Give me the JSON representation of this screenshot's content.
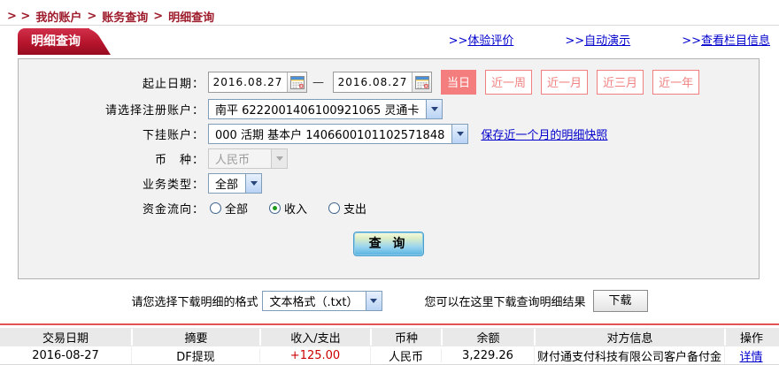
{
  "breadcrumb": {
    "prefix": "> >",
    "separator": ">",
    "items": [
      "我的账户",
      "账务查询",
      "明细查询"
    ]
  },
  "panel": {
    "tab_title": "明细查询",
    "links": [
      {
        "prefix": ">>",
        "label": "体验评价"
      },
      {
        "prefix": ">>",
        "label": "自动演示"
      },
      {
        "prefix": ">>",
        "label": "查看栏目信息"
      }
    ]
  },
  "form": {
    "date_label": "起止日期：",
    "date_from": "2016.08.27",
    "date_to": "2016.08.27",
    "date_separator": "—",
    "quick_ranges": {
      "active": "当日",
      "buttons": [
        "当日",
        "近一周",
        "近一月",
        "近三月",
        "近一年"
      ]
    },
    "register_account_label": "请选择注册账户：",
    "register_account_value": "南平 6222001406100921065 灵通卡",
    "sub_account_label": "下挂账户：",
    "sub_account_value": "000 活期 基本户 1406600101102571848",
    "snapshot_link": "保存近一个月的明细快照",
    "currency_label": "币　种：",
    "currency_value": "人民币",
    "currency_disabled": true,
    "biz_type_label": "业务类型：",
    "biz_type_value": "全部",
    "flow_label": "资金流向：",
    "flow_options": [
      {
        "label": "全部",
        "selected": false
      },
      {
        "label": "收入",
        "selected": true
      },
      {
        "label": "支出",
        "selected": false
      }
    ],
    "query_button": "查 询"
  },
  "download": {
    "format_label": "请您选择下载明细的格式",
    "format_value": "文本格式（.txt）",
    "hint_label": "您可以在这里下载查询明细结果",
    "button": "下载"
  },
  "table": {
    "headers": [
      "交易日期",
      "摘要",
      "收入/支出",
      "币种",
      "余额",
      "对方信息",
      "操作"
    ],
    "rows": [
      {
        "date": "2016-08-27",
        "summary": "DF提现",
        "amount": "+125.00",
        "currency": "人民币",
        "balance": "3,229.26",
        "counterparty": "财付通支付科技有限公司客户备付金",
        "action": "详情"
      }
    ]
  },
  "colors": {
    "brand_red": "#b6152d",
    "breadcrumb_red": "#9e1b2b",
    "link_blue": "#0000cc",
    "quick_btn_pink": "#f08080",
    "amount_red": "#cc0000",
    "table_rule_red": "#e25252"
  }
}
